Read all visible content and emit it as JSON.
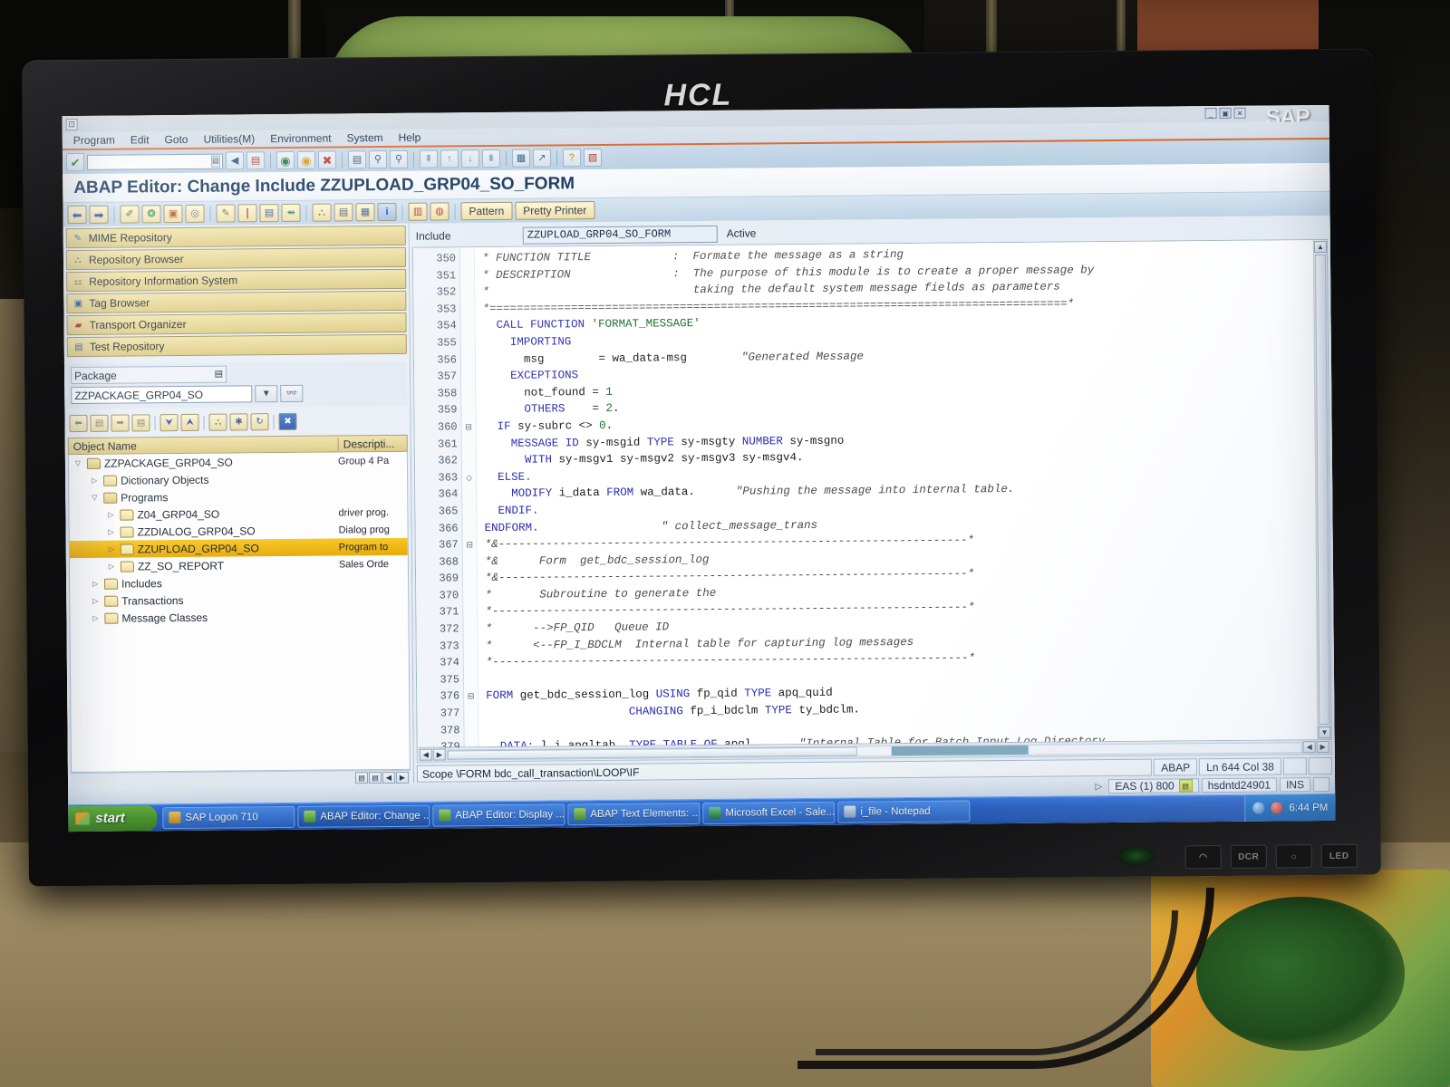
{
  "hardware": {
    "monitor_brand": "HCL",
    "bezel_buttons": [
      "eco-mode",
      "dcr",
      "brightness",
      "LED"
    ]
  },
  "window": {
    "app_brand": "SAP",
    "controls": [
      "minimize",
      "maximize",
      "close"
    ]
  },
  "menubar": {
    "items": [
      {
        "label": "Program"
      },
      {
        "label": "Edit"
      },
      {
        "label": "Goto"
      },
      {
        "label": "Utilities(M)"
      },
      {
        "label": "Environment"
      },
      {
        "label": "System"
      },
      {
        "label": "Help"
      }
    ]
  },
  "toolbar_main": {
    "command_field_value": "",
    "command_field_placeholder": "",
    "icons": [
      {
        "name": "enter-check-icon",
        "glyph": "✔",
        "color": "#1d7a2e"
      },
      {
        "name": "back-arrow-icon",
        "glyph": "◀",
        "color": "#2a4f7a"
      },
      {
        "name": "save-icon",
        "glyph": "▤",
        "color": "#b03a2a"
      },
      {
        "name": "back-icon",
        "glyph": "◉",
        "color": "#1f7a3c"
      },
      {
        "name": "exit-icon",
        "glyph": "◉",
        "color": "#d89a1f"
      },
      {
        "name": "cancel-icon",
        "glyph": "✖",
        "color": "#c0392b"
      },
      {
        "name": "print-icon",
        "glyph": "🖶",
        "color": "#3a5570"
      },
      {
        "name": "find-icon",
        "glyph": "🔍",
        "color": "#2a5a8a"
      },
      {
        "name": "find-next-icon",
        "glyph": "🔎",
        "color": "#2a5a8a"
      },
      {
        "name": "first-page-icon",
        "glyph": "⇞",
        "color": "#4a6a8a"
      },
      {
        "name": "previous-page-icon",
        "glyph": "↑",
        "color": "#4a6a8a"
      },
      {
        "name": "next-page-icon",
        "glyph": "↓",
        "color": "#4a6a8a"
      },
      {
        "name": "last-page-icon",
        "glyph": "⇟",
        "color": "#4a6a8a"
      },
      {
        "name": "new-session-icon",
        "glyph": "▦",
        "color": "#2a5a8a"
      },
      {
        "name": "create-shortcut-icon",
        "glyph": "↗",
        "color": "#2a5a8a"
      },
      {
        "name": "help-icon",
        "glyph": "?",
        "color": "#d8a41f"
      },
      {
        "name": "layout-menu-icon",
        "glyph": "▧",
        "color": "#b03a2a"
      }
    ]
  },
  "app_title": "ABAP Editor: Change Include ZZUPLOAD_GRP04_SO_FORM",
  "toolbar_app": {
    "icons": [
      {
        "name": "back-arrow-icon",
        "glyph": "⬅"
      },
      {
        "name": "forward-arrow-icon",
        "glyph": "➡"
      },
      {
        "name": "check-syntax-icon",
        "glyph": "✐"
      },
      {
        "name": "activate-icon",
        "glyph": "❂"
      },
      {
        "name": "test-icon",
        "glyph": "▣"
      },
      {
        "name": "where-used-icon",
        "glyph": "◎"
      },
      {
        "name": "display-change-icon",
        "glyph": "✎"
      },
      {
        "name": "insert-statement-icon",
        "glyph": "❘"
      },
      {
        "name": "object-list-icon",
        "glyph": "▤"
      },
      {
        "name": "navigate-icon",
        "glyph": "⇴"
      },
      {
        "name": "structure-icon",
        "glyph": "⛬"
      },
      {
        "name": "print-preview-icon",
        "glyph": "▤"
      },
      {
        "name": "documentation-icon",
        "glyph": "▦"
      },
      {
        "name": "info-icon",
        "glyph": "i"
      },
      {
        "name": "debug-icon",
        "glyph": "▥"
      },
      {
        "name": "breakpoint-icon",
        "glyph": "◍"
      }
    ],
    "pattern_label": "Pattern",
    "pretty_printer_label": "Pretty Printer"
  },
  "navigator": {
    "items": [
      {
        "label": "MIME Repository",
        "icon": "mime-repository-icon",
        "glyph": "✎"
      },
      {
        "label": "Repository Browser",
        "icon": "repository-browser-icon",
        "glyph": "⛬"
      },
      {
        "label": "Repository Information System",
        "icon": "repository-info-icon",
        "glyph": "⚏"
      },
      {
        "label": "Tag Browser",
        "icon": "tag-browser-icon",
        "glyph": "▣"
      },
      {
        "label": "Transport Organizer",
        "icon": "transport-organizer-icon",
        "glyph": "🚚"
      },
      {
        "label": "Test Repository",
        "icon": "test-repository-icon",
        "glyph": "▤"
      }
    ],
    "package_label": "Package",
    "package_value": "ZZPACKAGE_GRP04_SO",
    "package_dropdown_icon": "chevron-down-icon",
    "package_display_icon": "glasses-icon",
    "tree_tools": [
      {
        "name": "back-button",
        "glyph": "⬅"
      },
      {
        "name": "back-history-button",
        "glyph": "▤"
      },
      {
        "name": "forward-button",
        "glyph": "➡"
      },
      {
        "name": "forward-history-button",
        "glyph": "▤"
      },
      {
        "name": "collapse-button",
        "glyph": "⮟"
      },
      {
        "name": "expand-button",
        "glyph": "⮝"
      },
      {
        "name": "object-list-button",
        "glyph": "⛬"
      },
      {
        "name": "filter-button",
        "glyph": "✱"
      },
      {
        "name": "refresh-button",
        "glyph": "↻"
      },
      {
        "name": "close-button",
        "glyph": "✖"
      }
    ],
    "tree_headers": {
      "name": "Object Name",
      "description": "Descripti..."
    },
    "tree_rows": [
      {
        "indent": 0,
        "twist": "▽",
        "folder": "open",
        "label": "ZZPACKAGE_GRP04_SO",
        "desc": "Group 4 Pa",
        "selected": false
      },
      {
        "indent": 1,
        "twist": "▷",
        "folder": "closed",
        "label": "Dictionary Objects",
        "desc": "",
        "selected": false
      },
      {
        "indent": 1,
        "twist": "▽",
        "folder": "open",
        "label": "Programs",
        "desc": "",
        "selected": false
      },
      {
        "indent": 2,
        "twist": "▷",
        "folder": "closed",
        "label": "Z04_GRP04_SO",
        "desc": "driver prog.",
        "selected": false
      },
      {
        "indent": 2,
        "twist": "▷",
        "folder": "closed",
        "label": "ZZDIALOG_GRP04_SO",
        "desc": "Dialog prog",
        "selected": false
      },
      {
        "indent": 2,
        "twist": "▷",
        "folder": "closed",
        "label": "ZZUPLOAD_GRP04_SO",
        "desc": "Program to",
        "selected": true
      },
      {
        "indent": 2,
        "twist": "▷",
        "folder": "closed",
        "label": "ZZ_SO_REPORT",
        "desc": "Sales Orde",
        "selected": false
      },
      {
        "indent": 1,
        "twist": "▷",
        "folder": "closed",
        "label": "Includes",
        "desc": "",
        "selected": false
      },
      {
        "indent": 1,
        "twist": "▷",
        "folder": "closed",
        "label": "Transactions",
        "desc": "",
        "selected": false
      },
      {
        "indent": 1,
        "twist": "▷",
        "folder": "closed",
        "label": "Message Classes",
        "desc": "",
        "selected": false
      }
    ]
  },
  "editor": {
    "include_label": "Include",
    "include_value": "ZZUPLOAD_GRP04_SO_FORM",
    "status_label": "Active",
    "first_line_number": 350,
    "lines": [
      {
        "n": 350,
        "fold": "",
        "tokens": [
          {
            "t": "* FUNCTION TITLE            :  Formate the message as a string",
            "c": "cm"
          }
        ]
      },
      {
        "n": 351,
        "fold": "",
        "tokens": [
          {
            "t": "* DESCRIPTION               :  The purpose of this module is to create a proper message by",
            "c": "cm"
          }
        ]
      },
      {
        "n": 352,
        "fold": "",
        "tokens": [
          {
            "t": "*                              taking the default system message fields as parameters",
            "c": "cm"
          }
        ]
      },
      {
        "n": 353,
        "fold": "",
        "tokens": [
          {
            "t": "*=====================================================================================*",
            "c": "cm"
          }
        ]
      },
      {
        "n": 354,
        "fold": "",
        "tokens": [
          {
            "t": "  CALL FUNCTION ",
            "c": "kw"
          },
          {
            "t": "'FORMAT_MESSAGE'",
            "c": "lit"
          }
        ]
      },
      {
        "n": 355,
        "fold": "",
        "tokens": [
          {
            "t": "    IMPORTING",
            "c": "kw"
          }
        ]
      },
      {
        "n": 356,
        "fold": "",
        "tokens": [
          {
            "t": "      msg        = wa_data-msg        ",
            "c": "nm"
          },
          {
            "t": "\"Generated Message",
            "c": "cm"
          }
        ]
      },
      {
        "n": 357,
        "fold": "",
        "tokens": [
          {
            "t": "    EXCEPTIONS",
            "c": "kw"
          }
        ]
      },
      {
        "n": 358,
        "fold": "",
        "tokens": [
          {
            "t": "      not_found = ",
            "c": "nm"
          },
          {
            "t": "1",
            "c": "lit"
          }
        ]
      },
      {
        "n": 359,
        "fold": "",
        "tokens": [
          {
            "t": "      OTHERS    ",
            "c": "kw"
          },
          {
            "t": "= ",
            "c": "nm"
          },
          {
            "t": "2",
            "c": "lit"
          },
          {
            "t": ".",
            "c": "nm"
          }
        ]
      },
      {
        "n": 360,
        "fold": "⊟",
        "tokens": [
          {
            "t": "  IF ",
            "c": "kw"
          },
          {
            "t": "sy-subrc <> ",
            "c": "nm"
          },
          {
            "t": "0",
            "c": "lit"
          },
          {
            "t": ".",
            "c": "nm"
          }
        ]
      },
      {
        "n": 361,
        "fold": "",
        "tokens": [
          {
            "t": "    MESSAGE ID ",
            "c": "kw"
          },
          {
            "t": "sy-msgid ",
            "c": "nm"
          },
          {
            "t": "TYPE ",
            "c": "kw"
          },
          {
            "t": "sy-msgty ",
            "c": "nm"
          },
          {
            "t": "NUMBER ",
            "c": "kw"
          },
          {
            "t": "sy-msgno",
            "c": "nm"
          }
        ]
      },
      {
        "n": 362,
        "fold": "",
        "tokens": [
          {
            "t": "      WITH ",
            "c": "kw"
          },
          {
            "t": "sy-msgv1 sy-msgv2 sy-msgv3 sy-msgv4.",
            "c": "nm"
          }
        ]
      },
      {
        "n": 363,
        "fold": "◇",
        "tokens": [
          {
            "t": "  ELSE.",
            "c": "kw"
          }
        ]
      },
      {
        "n": 364,
        "fold": "",
        "tokens": [
          {
            "t": "    MODIFY ",
            "c": "kw"
          },
          {
            "t": "i_data ",
            "c": "nm"
          },
          {
            "t": "FROM ",
            "c": "kw"
          },
          {
            "t": "wa_data.      ",
            "c": "nm"
          },
          {
            "t": "\"Pushing the message into internal table.",
            "c": "cm"
          }
        ]
      },
      {
        "n": 365,
        "fold": "",
        "tokens": [
          {
            "t": "  ENDIF.",
            "c": "kw"
          }
        ]
      },
      {
        "n": 366,
        "fold": "",
        "tokens": [
          {
            "t": "ENDFORM.",
            "c": "kw"
          },
          {
            "t": "                  ",
            "c": "nm"
          },
          {
            "t": "\" collect_message_trans",
            "c": "cm"
          }
        ]
      },
      {
        "n": 367,
        "fold": "⊟",
        "tokens": [
          {
            "t": "*&---------------------------------------------------------------------*",
            "c": "cm"
          }
        ]
      },
      {
        "n": 368,
        "fold": "",
        "tokens": [
          {
            "t": "*&      Form  get_bdc_session_log",
            "c": "cm"
          }
        ]
      },
      {
        "n": 369,
        "fold": "",
        "tokens": [
          {
            "t": "*&---------------------------------------------------------------------*",
            "c": "cm"
          }
        ]
      },
      {
        "n": 370,
        "fold": "",
        "tokens": [
          {
            "t": "*       Subroutine to generate the",
            "c": "cm"
          }
        ]
      },
      {
        "n": 371,
        "fold": "",
        "tokens": [
          {
            "t": "*----------------------------------------------------------------------*",
            "c": "cm"
          }
        ]
      },
      {
        "n": 372,
        "fold": "",
        "tokens": [
          {
            "t": "*      -->FP_QID   Queue ID",
            "c": "cm"
          }
        ]
      },
      {
        "n": 373,
        "fold": "",
        "tokens": [
          {
            "t": "*      <--FP_I_BDCLM  Internal table for capturing log messages",
            "c": "cm"
          }
        ]
      },
      {
        "n": 374,
        "fold": "",
        "tokens": [
          {
            "t": "*----------------------------------------------------------------------*",
            "c": "cm"
          }
        ]
      },
      {
        "n": 375,
        "fold": "",
        "tokens": [
          {
            "t": "",
            "c": "nm"
          }
        ]
      },
      {
        "n": 376,
        "fold": "⊟",
        "tokens": [
          {
            "t": "FORM ",
            "c": "kw"
          },
          {
            "t": "get_bdc_session_log ",
            "c": "nm"
          },
          {
            "t": "USING ",
            "c": "kw"
          },
          {
            "t": "fp_qid ",
            "c": "nm"
          },
          {
            "t": "TYPE ",
            "c": "kw"
          },
          {
            "t": "apq_quid",
            "c": "nm"
          }
        ]
      },
      {
        "n": 377,
        "fold": "",
        "tokens": [
          {
            "t": "                     CHANGING ",
            "c": "kw"
          },
          {
            "t": "fp_i_bdclm ",
            "c": "nm"
          },
          {
            "t": "TYPE ",
            "c": "kw"
          },
          {
            "t": "ty_bdclm.",
            "c": "nm"
          }
        ]
      },
      {
        "n": 378,
        "fold": "",
        "tokens": [
          {
            "t": "",
            "c": "nm"
          }
        ]
      },
      {
        "n": 379,
        "fold": "",
        "tokens": [
          {
            "t": "  DATA: ",
            "c": "kw"
          },
          {
            "t": "l_i_apqltab  ",
            "c": "nm"
          },
          {
            "t": "TYPE TABLE OF ",
            "c": "kw"
          },
          {
            "t": "apql,      ",
            "c": "nm"
          },
          {
            "t": "\"Internal Table for Batch Input Log Directory",
            "c": "cm"
          }
        ]
      }
    ],
    "scope": "Scope \\FORM bdc_call_transaction\\LOOP\\IF",
    "language": "ABAP",
    "cursor_position": "Ln 644 Col  38"
  },
  "statusbar": {
    "system": "EAS (1) 800",
    "host": "hsdntd24901",
    "insert_mode": "INS",
    "status_icon": "servers-icon"
  },
  "taskbar": {
    "start_label": "start",
    "tasks": [
      {
        "label": "SAP Logon 710",
        "icon": "sap-logon-icon",
        "type": "sap",
        "active": false
      },
      {
        "label": "ABAP Editor: Change ...",
        "icon": "abap-editor-icon",
        "type": "abap",
        "active": true
      },
      {
        "label": "ABAP Editor: Display ...",
        "icon": "abap-editor-icon",
        "type": "abap",
        "active": false
      },
      {
        "label": "ABAP Text Elements: ...",
        "icon": "abap-editor-icon",
        "type": "abap",
        "active": false
      },
      {
        "label": "Microsoft Excel - Sale...",
        "icon": "excel-icon",
        "type": "xls",
        "active": false
      },
      {
        "label": "i_file - Notepad",
        "icon": "notepad-icon",
        "type": "npd",
        "active": false
      }
    ],
    "tray_clock": "6:44 PM"
  },
  "colors": {
    "sap_accent": "#e06a2a",
    "nav_gold": "#ddcb84",
    "selection_gold": "#f0b400",
    "taskbar_blue": "#245fc4",
    "start_green": "#4e9c2c"
  }
}
